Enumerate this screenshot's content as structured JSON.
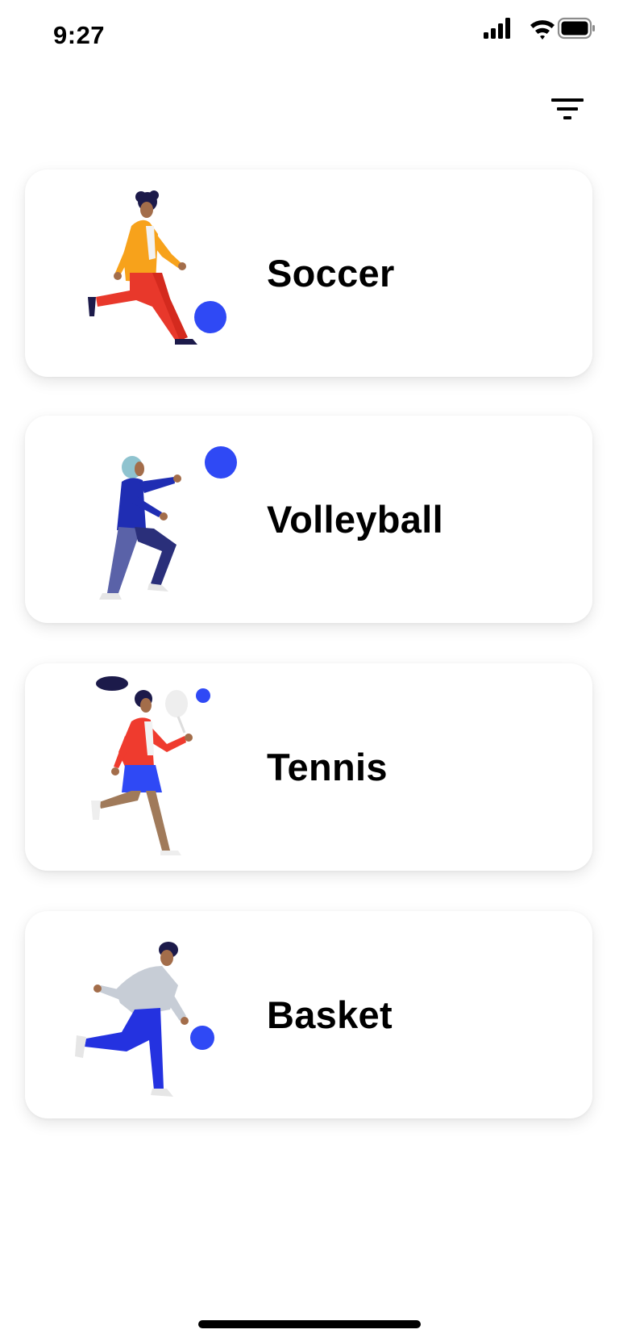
{
  "status_bar": {
    "time": "9:27",
    "icons": [
      "cellular-signal-icon",
      "wifi-icon",
      "battery-icon"
    ]
  },
  "header": {
    "filter_icon": "filter-icon"
  },
  "sports": [
    {
      "label": "Soccer",
      "illustration": "soccer-player-icon"
    },
    {
      "label": "Volleyball",
      "illustration": "volleyball-player-icon"
    },
    {
      "label": "Tennis",
      "illustration": "tennis-player-icon"
    },
    {
      "label": "Basket",
      "illustration": "basketball-player-icon"
    }
  ],
  "colors": {
    "ball_blue": "#2f49f5",
    "background": "#ffffff",
    "text": "#000000"
  }
}
